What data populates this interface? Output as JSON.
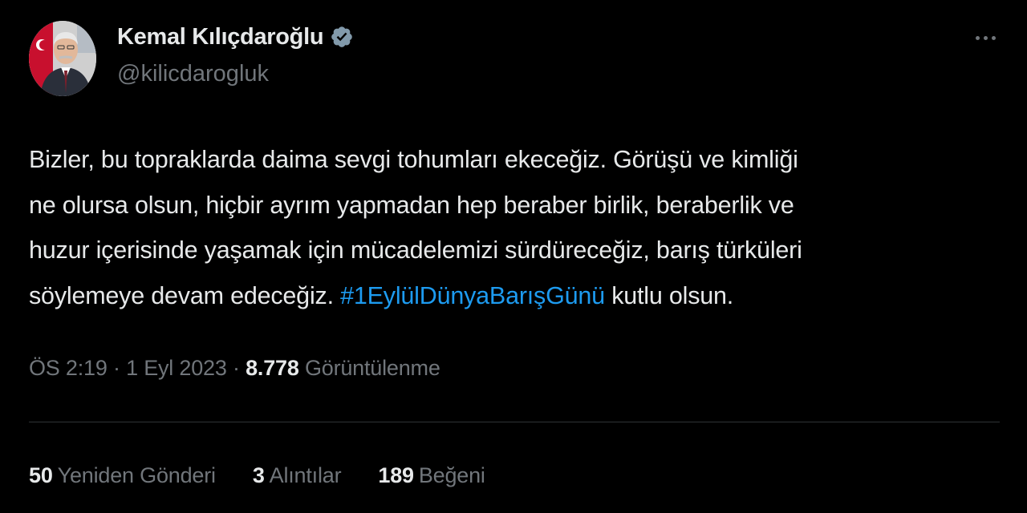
{
  "author": {
    "name": "Kemal Kılıçdaroğlu",
    "handle": "@kilicdarogluk",
    "verified": true
  },
  "tweet": {
    "lines": [
      "Bizler, bu topraklarda daima sevgi tohumları ekeceğiz. Görüşü ve kimliği",
      "ne olursa olsun, hiçbir ayrım yapmadan hep beraber birlik, beraberlik ve",
      "huzur içerisinde yaşamak için mücadelemizi sürdüreceğiz, barış türküleri"
    ],
    "last_line_before": "söylemeye devam edeceğiz. ",
    "hashtag": "#1EylülDünyaBarışGünü",
    "last_line_after": " kutlu olsun."
  },
  "meta": {
    "time": "ÖS 2:19",
    "sep1": " · ",
    "date": "1 Eyl 2023",
    "sep2": " · ",
    "views_count": "8.778",
    "views_label": " Görüntülenme"
  },
  "stats": {
    "reposts_count": "50",
    "reposts_label": "Yeniden Gönderi",
    "quotes_count": "3",
    "quotes_label": "Alıntılar",
    "likes_count": "189",
    "likes_label": "Beğeni"
  },
  "colors": {
    "background": "#000000",
    "text_primary": "#e7e9ea",
    "text_secondary": "#71767b",
    "link": "#1d9bf0",
    "divider": "#2f3336",
    "verified_badge": "#829aab"
  },
  "icons": {
    "verified": "verified-badge-icon",
    "more": "more-dots-icon"
  }
}
